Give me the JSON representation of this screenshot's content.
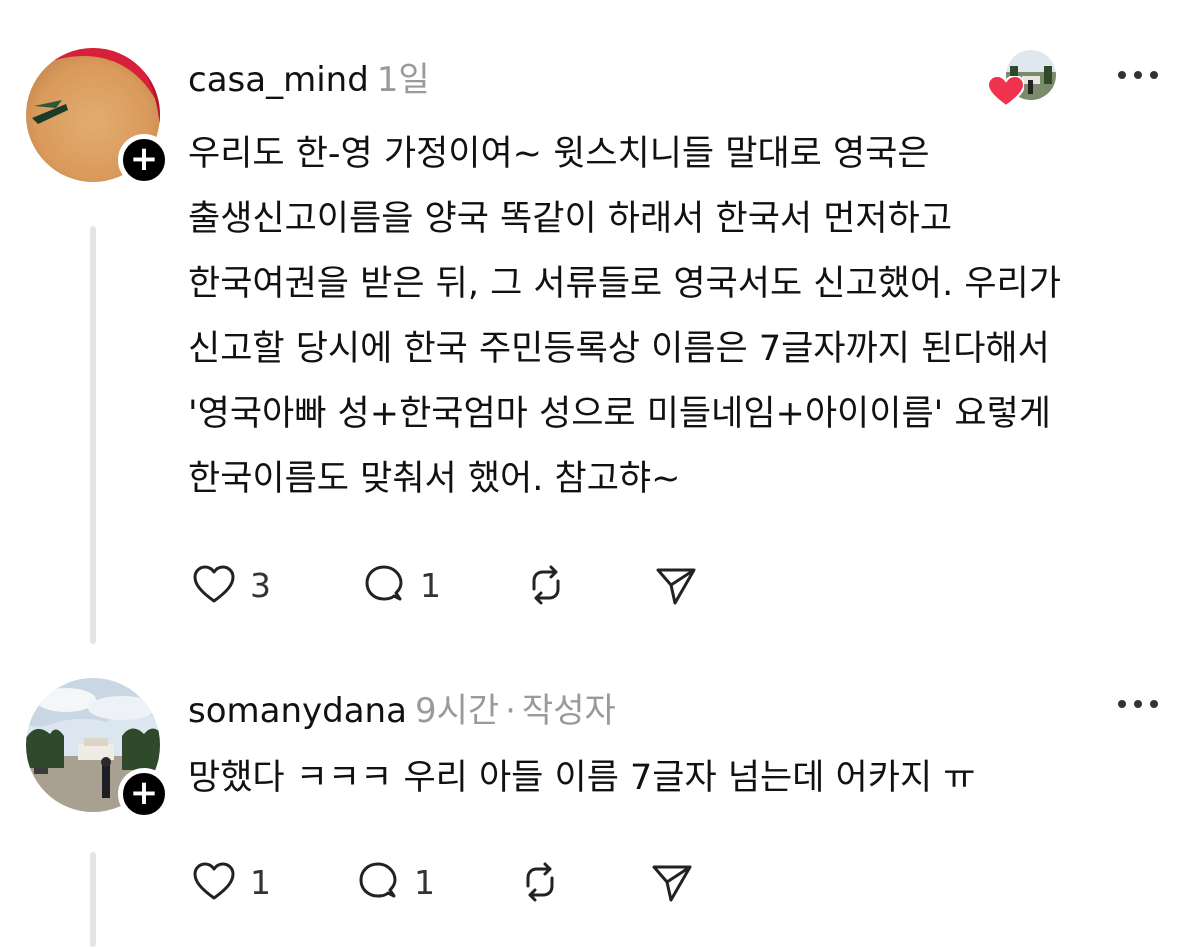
{
  "posts": [
    {
      "username": "casa_mind",
      "time": "1일",
      "author_tag": "",
      "lines": [
        "우리도 한-영 가정이여~ 윗스치니들 말대로 영국은",
        "출생신고이름을 양국 똑같이 하래서 한국서 먼저하고",
        "한국여권을 받은 뒤, 그 서류들로 영국서도 신고했어. 우리가",
        "신고할 당시에 한국 주민등록상 이름은 7글자까지 된다해서",
        "'영국아빠 성+한국엄마 성으로 미들네임+아이이름' 요렇게",
        "한국이름도 맞춰서 했어. 참고햐~"
      ],
      "likes": "3",
      "replies": "1",
      "follow_glyph": "+"
    },
    {
      "username": "somanydana",
      "time": "9시간",
      "separator": "·",
      "author_tag": "작성자",
      "lines": [
        "망했다 ㅋㅋㅋ 우리 아들 이름 7글자 넘는데 어카지 ㅠ"
      ],
      "likes": "1",
      "replies": "1",
      "follow_glyph": "+"
    }
  ],
  "icons": {
    "like": "heart-outline-icon",
    "reply": "speech-bubble-icon",
    "repost": "repost-arrows-icon",
    "share": "paper-plane-icon",
    "more": "more-horizontal-icon",
    "liked_heart": "heart-filled-icon"
  },
  "colors": {
    "text": "#111111",
    "meta": "#9a9a9a",
    "heart": "#f0324e",
    "thread_line": "#e4e4e4"
  }
}
